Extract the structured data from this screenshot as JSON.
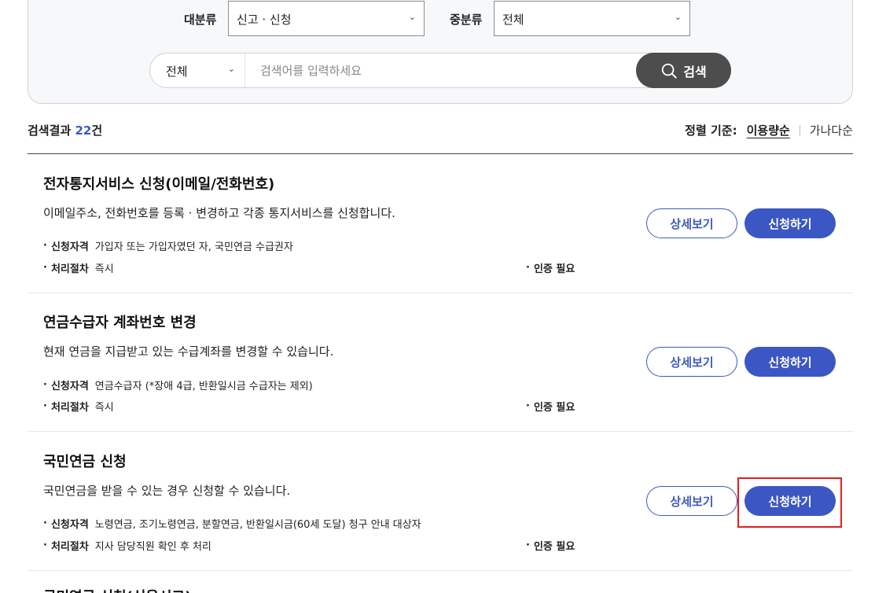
{
  "filters": {
    "category_label": "대분류",
    "category_value": "신고 · 신청",
    "subcategory_label": "중분류",
    "subcategory_value": "전체"
  },
  "search": {
    "scope_value": "전체",
    "placeholder": "검색어를 입력하세요",
    "button_label": "검색"
  },
  "results": {
    "prefix": "검색결과",
    "count": "22",
    "suffix": "건"
  },
  "sort": {
    "label": "정렬 기준:",
    "options": [
      "이용량순",
      "가나다순"
    ],
    "active": "이용량순"
  },
  "buttons": {
    "detail": "상세보기",
    "apply": "신청하기"
  },
  "items": [
    {
      "title": "전자통지서비스 신청(이메일/전화번호)",
      "description": "이메일주소, 전화번호를 등록 · 변경하고 각종 통지서비스를 신청합니다.",
      "eligibility_label": "신청자격",
      "eligibility": "가입자 또는 가입자였던 자, 국민연금 수급권자",
      "process_label": "처리절차",
      "process": "즉시",
      "auth": "인증 필요"
    },
    {
      "title": "연금수급자 계좌번호 변경",
      "description": "현재 연금을 지급받고 있는 수급계좌를 변경할 수 있습니다.",
      "eligibility_label": "신청자격",
      "eligibility": "연금수급자 (*장애 4급, 반환일시금 수급자는 제외)",
      "process_label": "처리절차",
      "process": "즉시",
      "auth": "인증 필요"
    },
    {
      "title": "국민연금 신청",
      "description": "국민연금을 받을 수 있는 경우 신청할 수 있습니다.",
      "eligibility_label": "신청자격",
      "eligibility": "노령연금, 조기노령연금, 분할연금, 반환일시금(60세 도달) 청구 안내 대상자",
      "process_label": "처리절차",
      "process": "지사 담당직원 확인 후 처리",
      "auth": "인증 필요"
    }
  ],
  "partial_item_title": "국민연금 신청(신용시고)"
}
